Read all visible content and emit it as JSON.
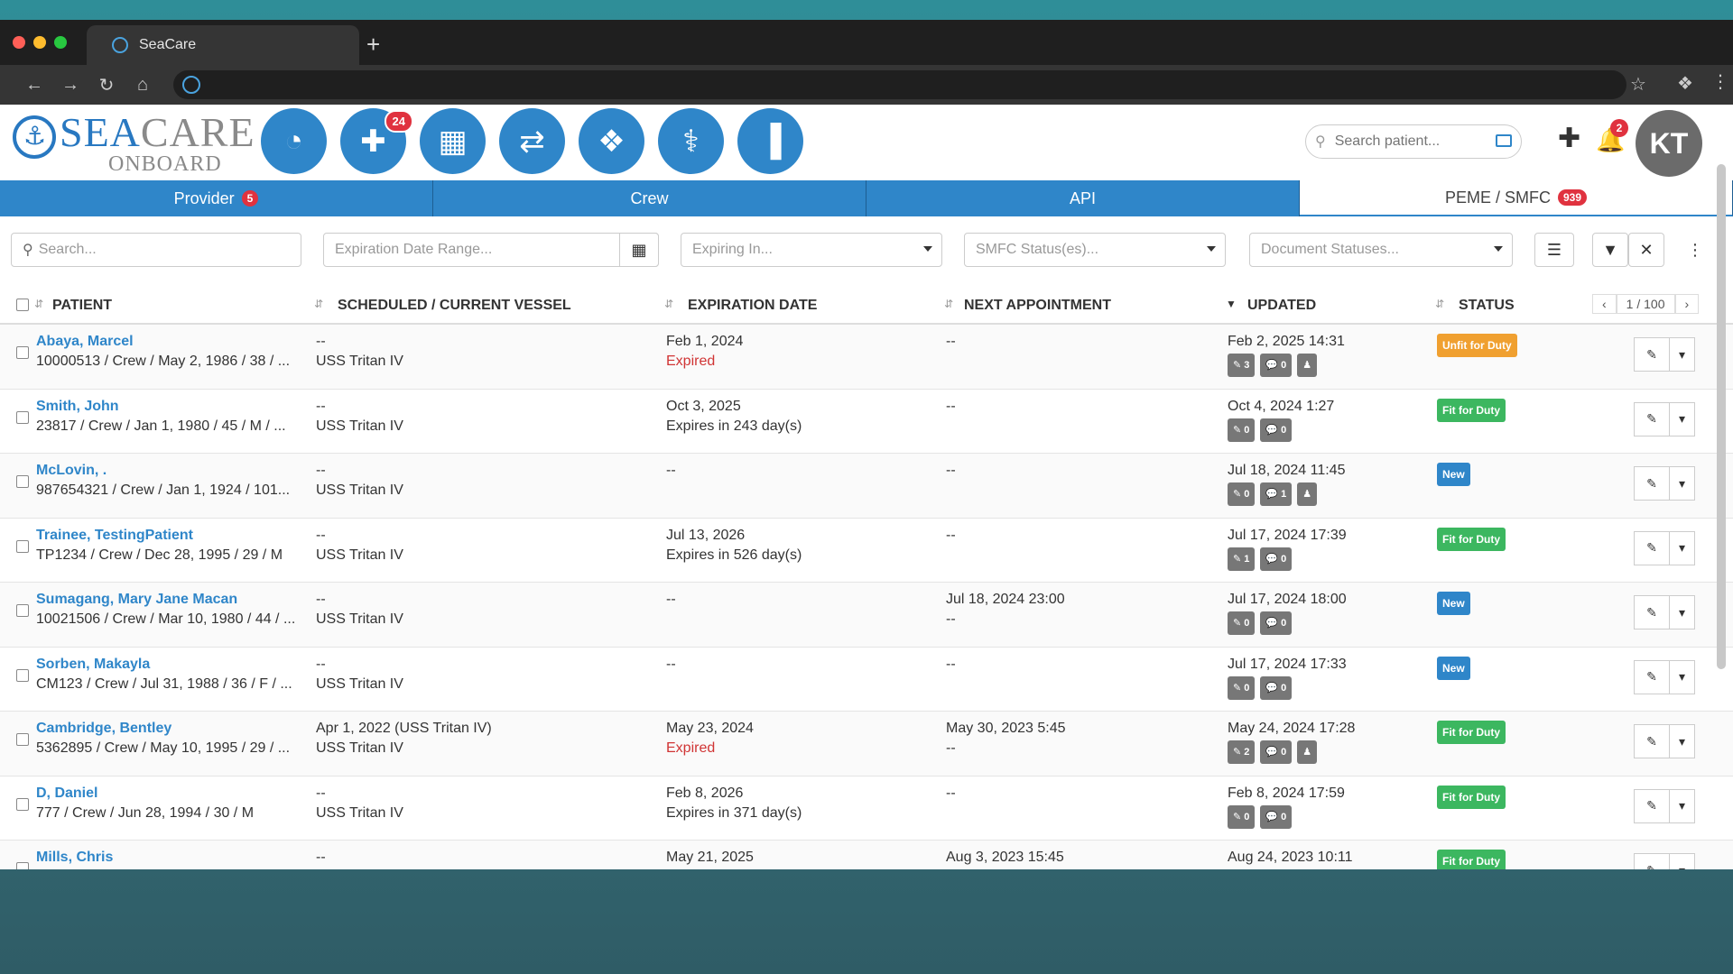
{
  "browser": {
    "tab_title": "SeaCare",
    "new_tab_symbol": "+"
  },
  "logo": {
    "line1_a": "SEA",
    "line1_b": "CARE",
    "line2": "ONBOARD"
  },
  "nav_icons": [
    {
      "name": "dashboard-pie-icon",
      "glyph": "◔"
    },
    {
      "name": "medical-add-icon",
      "glyph": "✚",
      "badge": "24"
    },
    {
      "name": "calendar-icon",
      "glyph": "▦"
    },
    {
      "name": "transfer-icon",
      "glyph": "⇄"
    },
    {
      "name": "dropbox-icon",
      "glyph": "❖"
    },
    {
      "name": "stethoscope-icon",
      "glyph": "⚕"
    },
    {
      "name": "bar-chart-icon",
      "glyph": "▐"
    }
  ],
  "header": {
    "search_placeholder": "Search patient...",
    "notification_count": "2",
    "avatar_initials": "KT"
  },
  "tabs": [
    {
      "label": "Provider",
      "badge": "5"
    },
    {
      "label": "Crew",
      "badge": ""
    },
    {
      "label": "API",
      "badge": ""
    },
    {
      "label": "PEME / SMFC",
      "badge": "939"
    }
  ],
  "filters": {
    "search_placeholder": "Search...",
    "expiration_placeholder": "Expiration Date Range...",
    "expiring_in": "Expiring In...",
    "smfc_status": "SMFC Status(es)...",
    "document_statuses": "Document Statuses..."
  },
  "columns": {
    "patient": "PATIENT",
    "vessel": "SCHEDULED / CURRENT VESSEL",
    "expiration": "EXPIRATION DATE",
    "next_appt": "NEXT APPOINTMENT",
    "updated": "UPDATED",
    "status": "STATUS"
  },
  "pager": {
    "label": "1 / 100",
    "prev": "‹",
    "next": "›"
  },
  "rows": [
    {
      "name": "Abaya, Marcel",
      "detail": "10000513 / Crew / May 2, 1986 / 38 / ...",
      "sched": "--",
      "vessel": "USS Tritan IV",
      "exp1": "Feb 1, 2024",
      "exp2": "Expired",
      "exp2_expired": true,
      "appt1": "--",
      "appt2": "",
      "upd": "Feb 2, 2025 14:31",
      "b1": "3",
      "b2": "0",
      "b3": true,
      "status": "Unfit for Duty",
      "stype": "unfit"
    },
    {
      "name": "Smith, John",
      "detail": "23817 / Crew / Jan 1, 1980 / 45 / M / ...",
      "sched": "--",
      "vessel": "USS Tritan IV",
      "exp1": "Oct 3, 2025",
      "exp2": "Expires in 243 day(s)",
      "exp2_expired": false,
      "appt1": "--",
      "appt2": "",
      "upd": "Oct 4, 2024 1:27",
      "b1": "0",
      "b2": "0",
      "b3": false,
      "status": "Fit for Duty",
      "stype": "fit"
    },
    {
      "name": "McLovin, .",
      "detail": "987654321 / Crew / Jan 1, 1924 / 101...",
      "sched": "--",
      "vessel": "USS Tritan IV",
      "exp1": "--",
      "exp2": "",
      "exp2_expired": false,
      "appt1": "--",
      "appt2": "",
      "upd": "Jul 18, 2024 11:45",
      "b1": "0",
      "b2": "1",
      "b3": true,
      "status": "New",
      "stype": "new"
    },
    {
      "name": "Trainee, TestingPatient",
      "detail": "TP1234 / Crew / Dec 28, 1995 / 29 / M",
      "sched": "--",
      "vessel": "USS Tritan IV",
      "exp1": "Jul 13, 2026",
      "exp2": "Expires in 526 day(s)",
      "exp2_expired": false,
      "appt1": "--",
      "appt2": "",
      "upd": "Jul 17, 2024 17:39",
      "b1": "1",
      "b2": "0",
      "b3": false,
      "status": "Fit for Duty",
      "stype": "fit"
    },
    {
      "name": "Sumagang, Mary Jane Macan",
      "detail": "10021506 / Crew / Mar 10, 1980 / 44 / ...",
      "sched": "--",
      "vessel": "USS Tritan IV",
      "exp1": "--",
      "exp2": "",
      "exp2_expired": false,
      "appt1": "Jul 18, 2024 23:00",
      "appt2": "--",
      "upd": "Jul 17, 2024 18:00",
      "b1": "0",
      "b2": "0",
      "b3": false,
      "status": "New",
      "stype": "new"
    },
    {
      "name": "Sorben, Makayla",
      "detail": "CM123 / Crew / Jul 31, 1988 / 36 / F / ...",
      "sched": "--",
      "vessel": "USS Tritan IV",
      "exp1": "--",
      "exp2": "",
      "exp2_expired": false,
      "appt1": "--",
      "appt2": "",
      "upd": "Jul 17, 2024 17:33",
      "b1": "0",
      "b2": "0",
      "b3": false,
      "status": "New",
      "stype": "new"
    },
    {
      "name": "Cambridge, Bentley",
      "detail": "5362895 / Crew / May 10, 1995 / 29 / ...",
      "sched": "Apr 1, 2022  (USS Tritan IV)",
      "vessel": "USS Tritan IV",
      "exp1": "May 23, 2024",
      "exp2": "Expired",
      "exp2_expired": true,
      "appt1": "May 30, 2023 5:45",
      "appt2": "--",
      "upd": "May 24, 2024 17:28",
      "b1": "2",
      "b2": "0",
      "b3": true,
      "status": "Fit for Duty",
      "stype": "fit"
    },
    {
      "name": "D, Daniel",
      "detail": "777 / Crew / Jun 28, 1994 / 30 / M",
      "sched": "--",
      "vessel": "USS Tritan IV",
      "exp1": "Feb 8, 2026",
      "exp2": "Expires in 371 day(s)",
      "exp2_expired": false,
      "appt1": "--",
      "appt2": "",
      "upd": "Feb 8, 2024 17:59",
      "b1": "0",
      "b2": "0",
      "b3": false,
      "status": "Fit for Duty",
      "stype": "fit"
    },
    {
      "name": "Mills, Chris",
      "detail": "",
      "sched": "--",
      "vessel": "",
      "exp1": "May 21, 2025",
      "exp2": "",
      "exp2_expired": false,
      "appt1": "Aug 3, 2023 15:45",
      "appt2": "",
      "upd": "Aug 24, 2023 10:11",
      "b1": "",
      "b2": "",
      "b3": false,
      "status": "Fit for Duty",
      "stype": "fit"
    }
  ]
}
